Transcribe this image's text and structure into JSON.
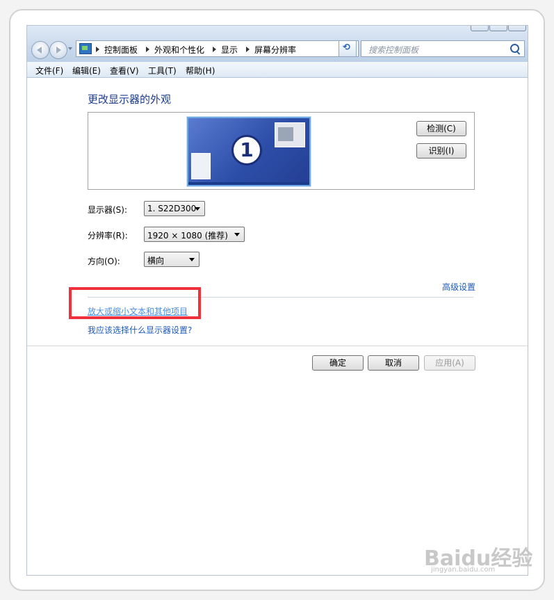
{
  "address": {
    "breadcrumbs": [
      "控制面板",
      "外观和个性化",
      "显示",
      "屏幕分辨率"
    ]
  },
  "search": {
    "placeholder": "搜索控制面板"
  },
  "menu": [
    "文件(F)",
    "编辑(E)",
    "查看(V)",
    "工具(T)",
    "帮助(H)"
  ],
  "main": {
    "heading": "更改显示器的外观",
    "monitor_number": "1",
    "detect_label": "检测(C)",
    "identify_label": "识别(I)",
    "display_label": "显示器(S):",
    "display_value": "1. S22D300",
    "resolution_label": "分辨率(R):",
    "resolution_value": "1920 × 1080 (推荐)",
    "orientation_label": "方向(O):",
    "orientation_value": "横向",
    "advanced_link": "高级设置",
    "zoom_link": "放大或缩小文本和其他项目",
    "which_link": "我应该选择什么显示器设置?"
  },
  "footer": {
    "ok": "确定",
    "cancel": "取消",
    "apply": "应用(A)"
  },
  "watermark": {
    "text": "Baidu经验",
    "sub": "jingyan.baidu.com"
  },
  "colors": {
    "highlight": "#f0303a",
    "link": "#1f5ab8",
    "heading": "#1e3d8f"
  }
}
